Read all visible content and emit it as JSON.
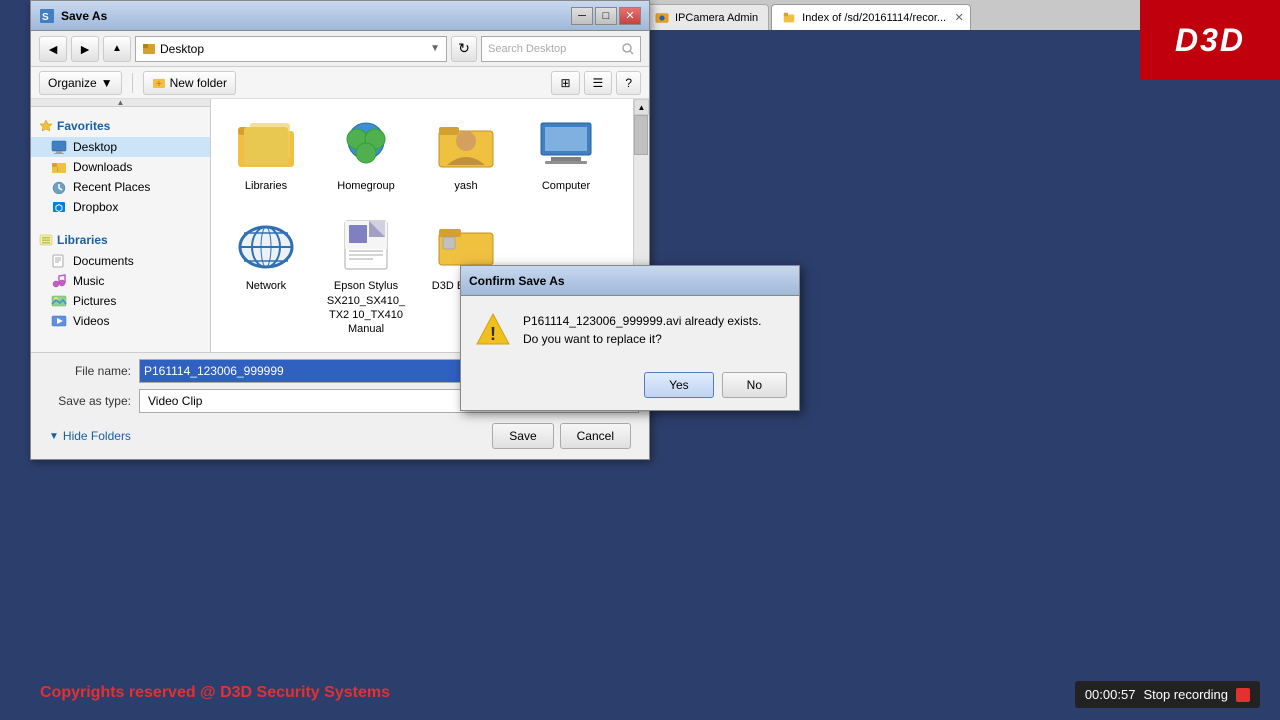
{
  "desktop": {
    "copyright": "Copyrights reserved @ D3D Security Systems",
    "logo": "D3D",
    "recording": {
      "time": "00:00:57",
      "label": "Stop recording"
    }
  },
  "browser_tabs": [
    {
      "label": "IPCamera Admin",
      "active": false,
      "icon": "camera"
    },
    {
      "label": "Index of /sd/20161114/recor...",
      "active": true,
      "icon": "folder-web"
    }
  ],
  "save_as_dialog": {
    "title": "Save As",
    "toolbar": {
      "back": "◄",
      "forward": "►",
      "up": "▲",
      "address": "Desktop",
      "search_placeholder": "Search Desktop",
      "organize": "Organize",
      "new_folder": "New folder"
    },
    "sidebar": {
      "favorites": {
        "label": "Favorites",
        "items": [
          {
            "name": "Desktop",
            "selected": true
          },
          {
            "name": "Downloads"
          },
          {
            "name": "Recent Places"
          },
          {
            "name": "Dropbox"
          }
        ]
      },
      "libraries": {
        "label": "Libraries",
        "items": [
          {
            "name": "Documents"
          },
          {
            "name": "Music"
          },
          {
            "name": "Pictures"
          },
          {
            "name": "Videos"
          }
        ]
      }
    },
    "files": [
      {
        "name": "Libraries",
        "type": "folder"
      },
      {
        "name": "Homegroup",
        "type": "homegroup"
      },
      {
        "name": "yash",
        "type": "user"
      },
      {
        "name": "Computer",
        "type": "computer"
      },
      {
        "name": "Network",
        "type": "network"
      },
      {
        "name": "Epson Stylus SX210_SX410_TX2 10_TX410 Manual",
        "type": "document"
      },
      {
        "name": "D3D Bell_W...",
        "type": "folder"
      }
    ],
    "file_name_label": "File name:",
    "file_name_value": "P161114_123006_999999",
    "save_type_label": "Save as type:",
    "save_type_value": "Video Clip",
    "hide_folders": "Hide Folders",
    "save_btn": "Save",
    "cancel_btn": "Cancel"
  },
  "confirm_dialog": {
    "title": "Confirm Save As",
    "message_line1": "P161114_123006_999999.avi already exists.",
    "message_line2": "Do you want to replace it?",
    "yes_btn": "Yes",
    "no_btn": "No"
  }
}
